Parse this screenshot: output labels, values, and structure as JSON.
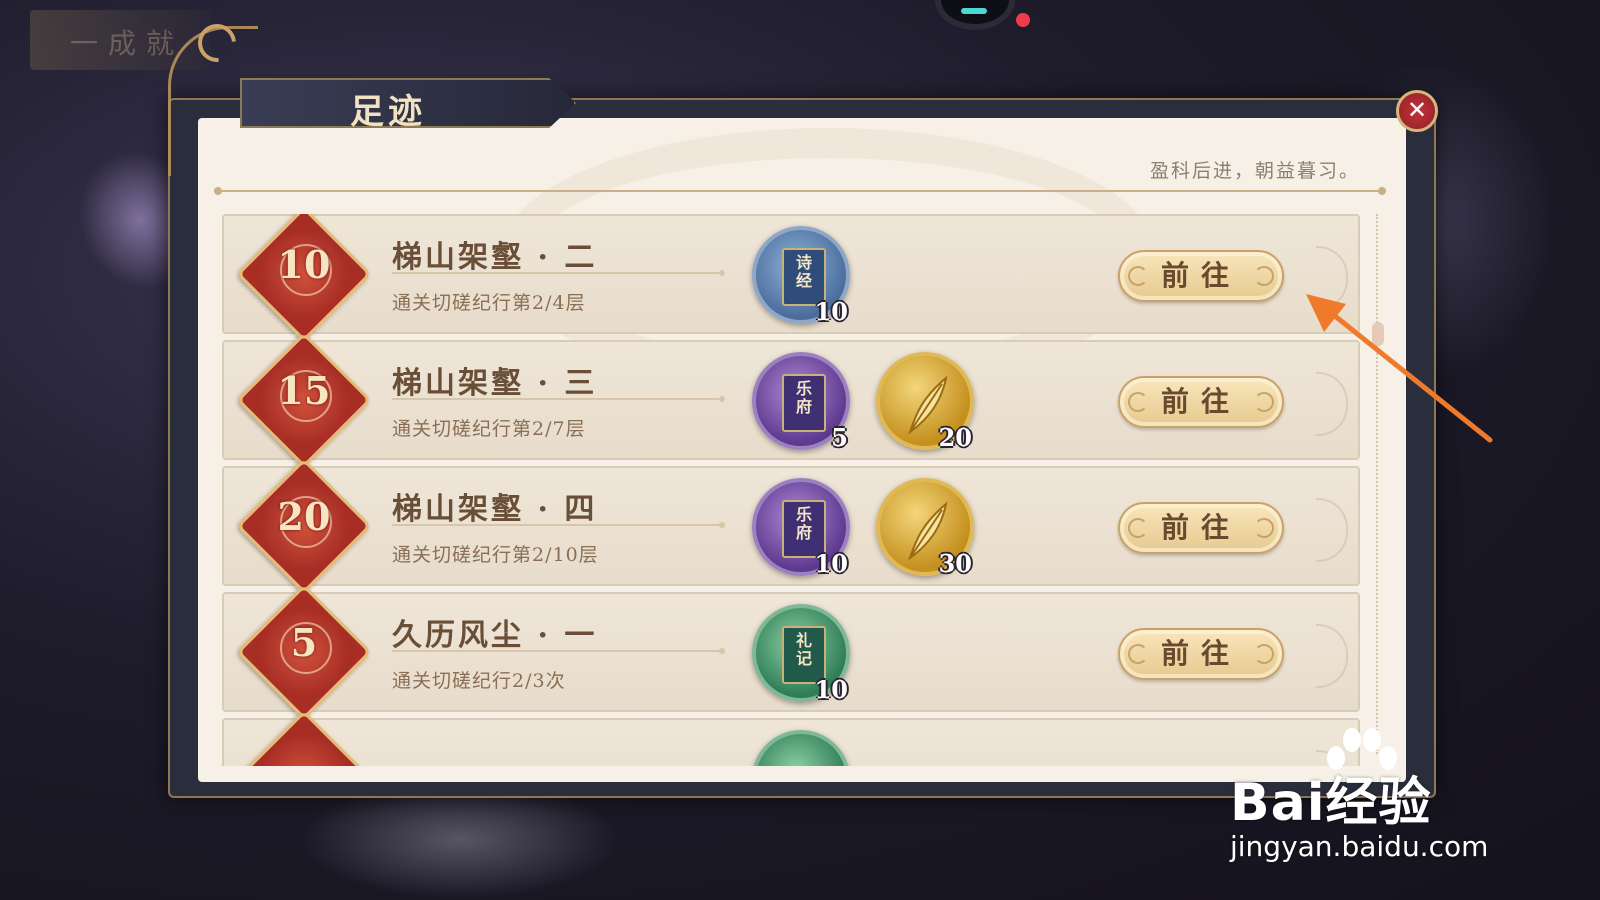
{
  "background": {
    "top_left_text": "一成就"
  },
  "panel": {
    "title": "足迹",
    "motto": "盈科后进，朝益暮习。",
    "close_icon": "close-icon"
  },
  "achievements": [
    {
      "badge": "10",
      "title": "梯山架壑 · 二",
      "desc": "通关切磋纪行第2/4层",
      "rewards": [
        {
          "icon": "book-shijing-icon",
          "label": "诗经",
          "style": "blue",
          "qty": "10"
        }
      ],
      "button": "前往"
    },
    {
      "badge": "15",
      "title": "梯山架壑 · 三",
      "desc": "通关切磋纪行第2/7层",
      "rewards": [
        {
          "icon": "book-yuefu-icon",
          "label": "乐府",
          "style": "purple",
          "qty": "5"
        },
        {
          "icon": "gold-feather-icon",
          "label": "",
          "style": "gold",
          "qty": "20"
        }
      ],
      "button": "前往"
    },
    {
      "badge": "20",
      "title": "梯山架壑 · 四",
      "desc": "通关切磋纪行第2/10层",
      "rewards": [
        {
          "icon": "book-yuefu-icon",
          "label": "乐府",
          "style": "purple",
          "qty": "10"
        },
        {
          "icon": "gold-feather-icon",
          "label": "",
          "style": "gold",
          "qty": "30"
        }
      ],
      "button": "前往"
    },
    {
      "badge": "5",
      "title": "久历风尘 · 一",
      "desc": "通关切磋纪行2/3次",
      "rewards": [
        {
          "icon": "book-liji-icon",
          "label": "礼记",
          "style": "green",
          "qty": "10"
        }
      ],
      "button": "前往"
    },
    {
      "badge": "",
      "title": "",
      "desc": "",
      "rewards": [],
      "button": ""
    }
  ],
  "colors": {
    "accent_gold": "#c9a26a",
    "badge_red": "#a72d25",
    "arrow_orange": "#f07a2c"
  },
  "watermark": {
    "logo": "Bai经验",
    "url": "jingyan.baidu.com"
  }
}
